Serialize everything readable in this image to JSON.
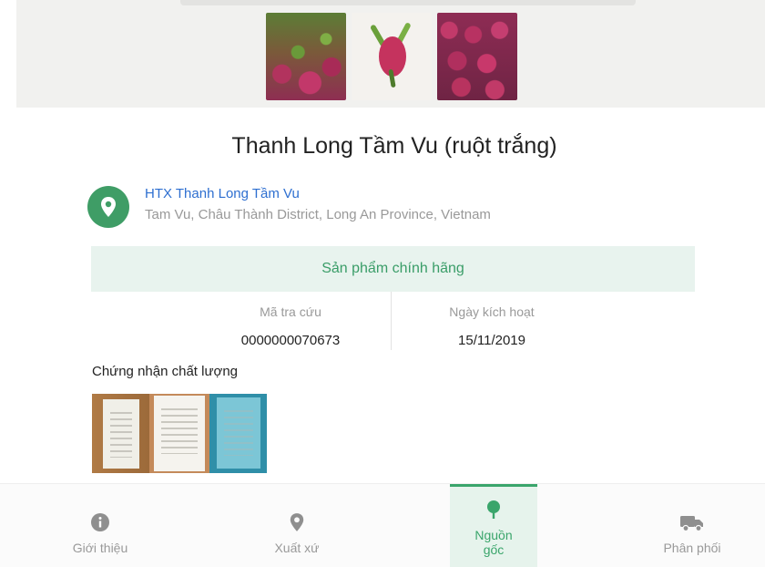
{
  "product": {
    "title": "Thanh Long Tầm Vu (ruột trắng)"
  },
  "producer": {
    "icon": "location-pin-icon",
    "name": "HTX Thanh Long Tầm Vu",
    "address": "Tam Vu, Châu Thành District, Long An Province, Vietnam"
  },
  "authentic": {
    "label": "Sản phẩm chính hãng"
  },
  "info": {
    "lookup_code_label": "Mã tra cứu",
    "lookup_code": "0000000070673",
    "activation_date_label": "Ngày kích hoạt",
    "activation_date": "15/11/2019"
  },
  "certification": {
    "heading": "Chứng nhận chất lượng"
  },
  "nav": {
    "items": [
      {
        "label": "Giới thiệu",
        "icon": "info-icon"
      },
      {
        "label": "Xuất xứ",
        "icon": "location-pin-icon"
      },
      {
        "label": "Nguồn gốc",
        "icon": "tree-icon",
        "active": true
      },
      {
        "label": "Phân phối",
        "icon": "truck-icon"
      }
    ]
  },
  "colors": {
    "accent": "#3aa56b",
    "link": "#2e6fd0",
    "banner_bg": "#e8f3ee"
  }
}
